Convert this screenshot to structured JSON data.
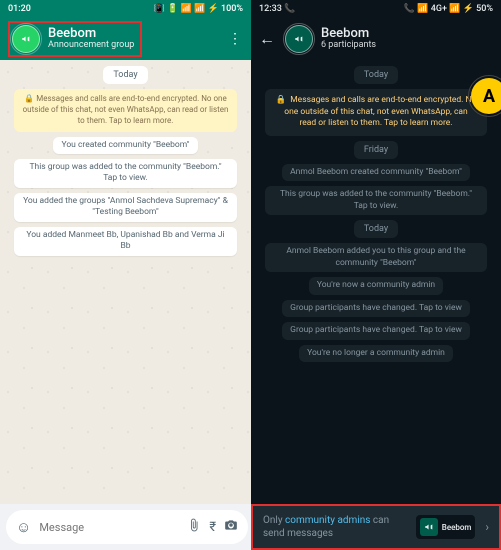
{
  "left": {
    "status": {
      "time": "01:20",
      "icons": "📳 🔋 📶 📶 ⚡ 100%"
    },
    "header": {
      "title": "Beebom",
      "subtitle": "Announcement group"
    },
    "day": "Today",
    "encryption": "Messages and calls are end-to-end encrypted. No one outside of this chat, not even WhatsApp, can read or listen to them. Tap to learn more.",
    "sys": [
      "You created community \"Beebom\"",
      "This group was added to the community \"Beebom.\" Tap to view.",
      "You added the groups \"Anmol Sachdeva Supremacy\" & \"Testing Beebom\"",
      "You added Manmeet Bb, Upanishad Bb and Verma Ji Bb"
    ],
    "input_placeholder": "Message"
  },
  "right": {
    "status": {
      "time": "12:33",
      "icons": "📞  📶 4G+ 📶 ⚡ 50%"
    },
    "header": {
      "title": "Beebom",
      "subtitle": "6 participants"
    },
    "avatar_letter": "A",
    "blocks": [
      {
        "kind": "date",
        "text": "Today"
      },
      {
        "kind": "enc",
        "text": "Messages and calls are end-to-end encrypted. No one outside of this chat, not even WhatsApp, can read or listen to them. Tap to learn more."
      },
      {
        "kind": "date",
        "text": "Friday"
      },
      {
        "kind": "sys",
        "text": "Anmol Beebom created community \"Beebom\""
      },
      {
        "kind": "sys",
        "text": "This group was added to the community \"Beebom.\" Tap to view."
      },
      {
        "kind": "date",
        "text": "Today"
      },
      {
        "kind": "sys",
        "text": "Anmol Beebom added you to this group and the community \"Beebom\""
      },
      {
        "kind": "sys",
        "text": "You're now a community admin"
      },
      {
        "kind": "sys",
        "text": "Group participants have changed. Tap to view"
      },
      {
        "kind": "sys",
        "text": "Group participants have changed. Tap to view"
      },
      {
        "kind": "sys",
        "text": "You're no longer a community admin"
      }
    ],
    "footer": {
      "prefix": "Only ",
      "link": "community admins",
      "suffix": " can send messages",
      "card_label": "Beebom"
    }
  }
}
